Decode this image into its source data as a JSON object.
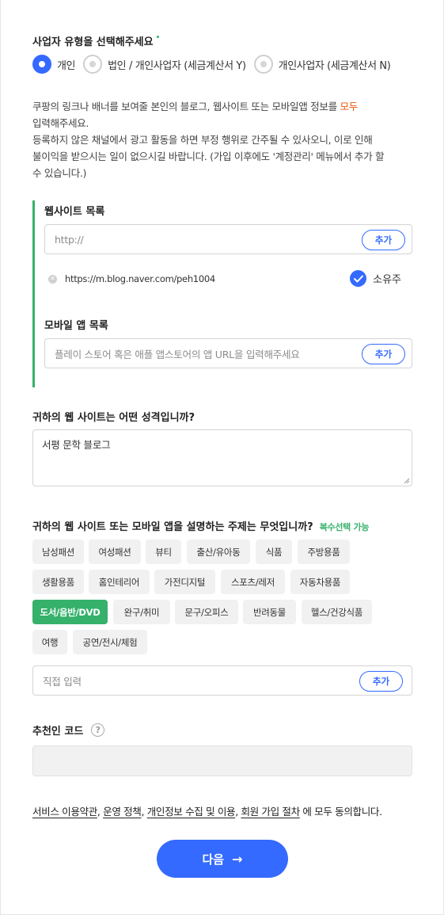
{
  "business_type": {
    "title": "사업자 유형을 선택해주세요",
    "options": [
      {
        "label": "개인",
        "selected": true
      },
      {
        "label": "법인 / 개인사업자 (세금계산서 Y)",
        "selected": false
      },
      {
        "label": "개인사업자 (세금계산서 N)",
        "selected": false
      }
    ]
  },
  "notice": {
    "line1_before": "쿠팡의 링크나 배너를 보여줄 본인의 블로그, 웹사이트 또는 모바일앱 정보를 ",
    "line1_highlight": "모두",
    "line2": "입력해주세요.",
    "line3": "등록하지 않은 채널에서 광고 활동을 하면 부정 행위로 간주될 수 있사오니, 이로 인해",
    "line4": "불이익을 받으시는 일이 없으시길 바랍니다. (가입 이후에도 '계정관리' 메뉴에서 추가 할",
    "line5": "수 있습니다.)"
  },
  "website": {
    "title": "웹사이트 목록",
    "placeholder": "http://",
    "add_label": "추가",
    "items": [
      {
        "url": "https://m.blog.naver.com/peh1004",
        "owner_label": "소유주",
        "owner_checked": true
      }
    ]
  },
  "mobile_app": {
    "title": "모바일 앱 목록",
    "placeholder": "플레이 스토어 혹은 애플 앱스토어의 앱 URL을 입력해주세요",
    "add_label": "추가"
  },
  "site_nature": {
    "title": "귀하의 웹 사이트는 어떤 성격입니까?",
    "value": "서평 문학 블로그"
  },
  "topics": {
    "title": "귀하의 웹 사이트 또는 모바일 앱을 설명하는 주제는 무엇입니까?",
    "multi_note": "복수선택 가능",
    "chips": [
      {
        "label": "남성패션",
        "selected": false
      },
      {
        "label": "여성패션",
        "selected": false
      },
      {
        "label": "뷰티",
        "selected": false
      },
      {
        "label": "출산/유아동",
        "selected": false
      },
      {
        "label": "식품",
        "selected": false
      },
      {
        "label": "주방용품",
        "selected": false
      },
      {
        "label": "생활용품",
        "selected": false
      },
      {
        "label": "홈인테리어",
        "selected": false
      },
      {
        "label": "가전디지털",
        "selected": false
      },
      {
        "label": "스포츠/레저",
        "selected": false
      },
      {
        "label": "자동차용품",
        "selected": false
      },
      {
        "label": "도서/음반/DVD",
        "selected": true
      },
      {
        "label": "완구/취미",
        "selected": false
      },
      {
        "label": "문구/오피스",
        "selected": false
      },
      {
        "label": "반려동물",
        "selected": false
      },
      {
        "label": "헬스/건강식품",
        "selected": false
      },
      {
        "label": "여행",
        "selected": false
      },
      {
        "label": "공연/전시/체험",
        "selected": false
      }
    ],
    "custom_placeholder": "직접 입력",
    "add_label": "추가"
  },
  "referral": {
    "title": "추천인 코드",
    "help_symbol": "?"
  },
  "agreement": {
    "links": [
      "서비스 이용약관",
      "운영 정책",
      "개인정보 수집 및 이용",
      "회원 가입 절차"
    ],
    "separator": ",",
    "suffix": " 에 모두 동의합니다."
  },
  "next_button": {
    "label": "다음",
    "arrow": "→"
  },
  "colors": {
    "primary": "#346aff",
    "green": "#35b16b",
    "highlight": "#e8590c"
  }
}
